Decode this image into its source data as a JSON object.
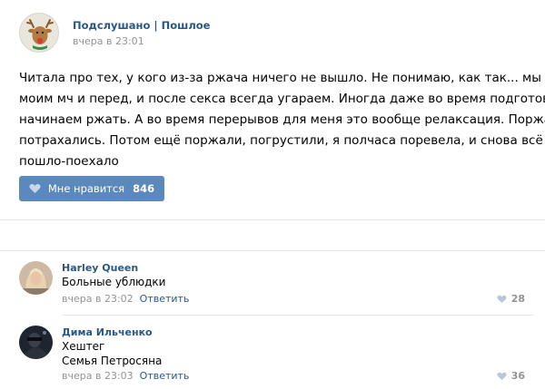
{
  "post": {
    "group_name": "Подслушано | Пошлое",
    "time": "вчера в 23:01",
    "text_lines": [
      "Читала про тех, у кого из-за ржача ничего не вышло. Не понимаю, как так... мы с",
      "моим мч и перед, и после секса всегда угараем. Иногда даже во время подготовки",
      "начинаем ржать. А во время перерывов для меня это вообще релаксация. Поржали,",
      "потрахались. Потом ещё поржали, погрустили, я полчаса поревела, и снова всё",
      "пошло-поехало"
    ],
    "like_label": "Мне нравится",
    "like_count": "846"
  },
  "comments": [
    {
      "author": "Harley Queen",
      "text_lines": [
        "Больные ублюдки"
      ],
      "time": "вчера в 23:02",
      "reply_label": "Ответить",
      "likes": "28"
    },
    {
      "author": "Дима Ильченко",
      "text_lines": [
        "Хештег",
        "Семья Петросяна"
      ],
      "time": "вчера в 23:03",
      "reply_label": "Ответить",
      "likes": "36"
    }
  ],
  "colors": {
    "link": "#2a5885",
    "like_button": "#5b88bd",
    "muted": "#939393",
    "divider": "#e7e8ec"
  },
  "icons": {
    "like_button_icon": "heart-icon",
    "comment_like_icon": "heart-icon",
    "group_avatar": "reindeer-avatar"
  }
}
